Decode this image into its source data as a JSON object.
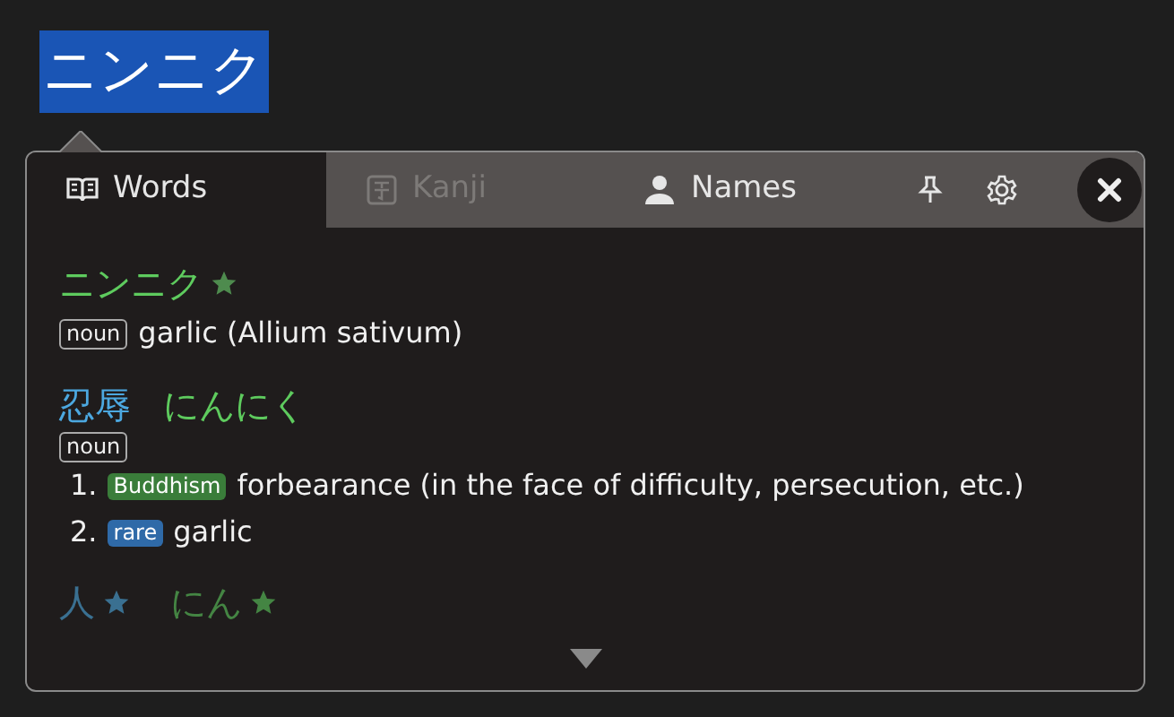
{
  "selection": "ニンニク",
  "tabs": [
    {
      "label": "Words",
      "kind": "words",
      "selected": true,
      "disabled": false
    },
    {
      "label": "Kanji",
      "kind": "kanji",
      "selected": false,
      "disabled": true
    },
    {
      "label": "Names",
      "kind": "names",
      "selected": false,
      "disabled": false
    }
  ],
  "entries": [
    {
      "kana": "ニンニク",
      "kana_common": true,
      "pos": "noun",
      "senses": [
        {
          "text": "garlic (Allium sativum)"
        }
      ]
    },
    {
      "kanji": "忍辱",
      "kana": "にんにく",
      "pos": "noun",
      "senses": [
        {
          "number": "1.",
          "tag": "Buddhism",
          "color": "#3a7d3a",
          "text": "forbearance (in the face of difficulty, persecution, etc.)"
        },
        {
          "number": "2.",
          "tag": "rare",
          "color": "#2f6aa8",
          "text": "garlic"
        }
      ]
    }
  ],
  "faded_entry": {
    "kanji": "人",
    "kanji_common": true,
    "kana": "にん",
    "kana_common": true
  }
}
